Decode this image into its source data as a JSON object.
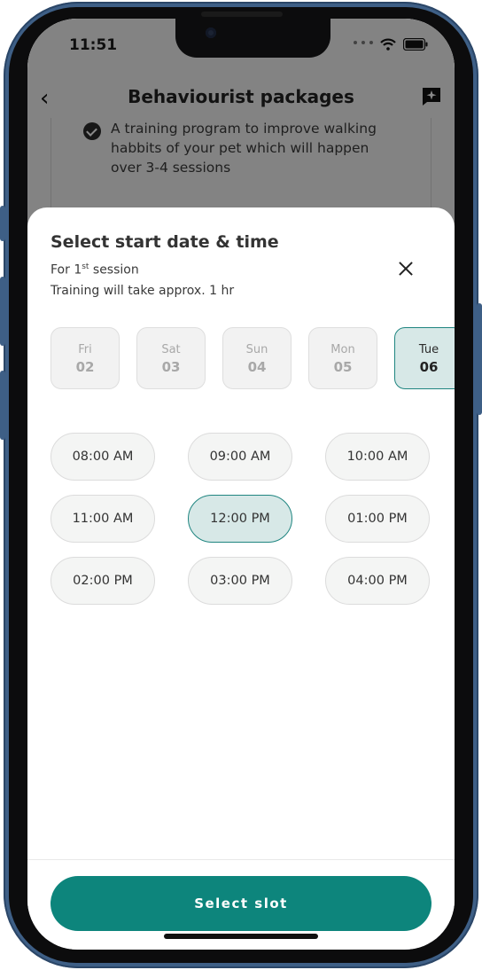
{
  "status_bar": {
    "time": "11:51"
  },
  "header": {
    "title": "Behaviourist packages",
    "back_icon": "back-arrow-icon",
    "chat_icon": "chat-sparkle-icon"
  },
  "background_card": {
    "description": "A training program to improve walking habbits of your pet which will happen over 3-4 sessions"
  },
  "sheet": {
    "title": "Select start date & time",
    "subtitle_prefix": "For 1",
    "subtitle_sup": "st",
    "subtitle_suffix": " session",
    "duration_note": "Training will take approx. 1 hr",
    "dates": [
      {
        "day": "Fri",
        "num": "02",
        "selected": false
      },
      {
        "day": "Sat",
        "num": "03",
        "selected": false
      },
      {
        "day": "Sun",
        "num": "04",
        "selected": false
      },
      {
        "day": "Mon",
        "num": "05",
        "selected": false
      },
      {
        "day": "Tue",
        "num": "06",
        "selected": true
      }
    ],
    "time_slots": [
      {
        "label": "08:00 AM",
        "selected": false
      },
      {
        "label": "09:00 AM",
        "selected": false
      },
      {
        "label": "10:00 AM",
        "selected": false
      },
      {
        "label": "11:00 AM",
        "selected": false
      },
      {
        "label": "12:00 PM",
        "selected": true
      },
      {
        "label": "01:00 PM",
        "selected": false
      },
      {
        "label": "02:00 PM",
        "selected": false
      },
      {
        "label": "03:00 PM",
        "selected": false
      },
      {
        "label": "04:00 PM",
        "selected": false
      }
    ],
    "cta_label": "Select slot"
  },
  "colors": {
    "accent": "#0d857c",
    "selected_bg": "#d7e8e7",
    "selected_border": "#1f8580",
    "frame": "#3e5f86"
  }
}
